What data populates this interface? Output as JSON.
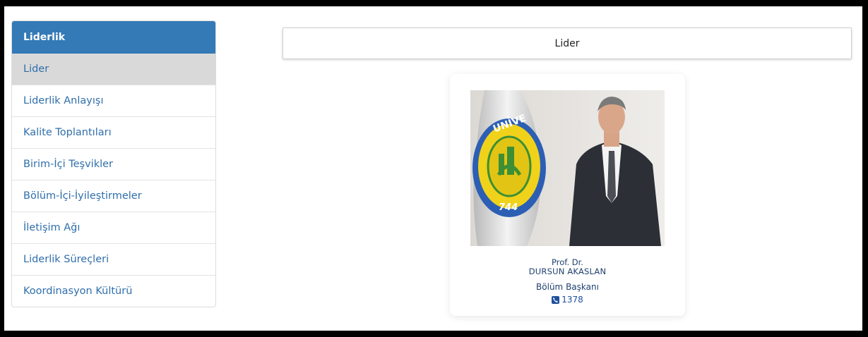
{
  "sidebar": {
    "header": "Liderlik",
    "items": [
      {
        "label": "Lider",
        "active": true
      },
      {
        "label": "Liderlik Anlayışı"
      },
      {
        "label": "Kalite Toplantıları"
      },
      {
        "label": "Birim-İçi Teşvikler"
      },
      {
        "label": "Bölüm-İçi-İyileştirmeler"
      },
      {
        "label": "İletişim Ağı"
      },
      {
        "label": "Liderlik Süreçleri"
      },
      {
        "label": "Koordinasyon Kültürü"
      }
    ]
  },
  "main": {
    "panel_title": "Lider"
  },
  "profile": {
    "photo_icon": "portrait-photo",
    "flag_number": "744",
    "flag_text": "UNİVE",
    "title": "Prof. Dr.",
    "name": "DURSUN AKASLAN",
    "role": "Bölüm Başkanı",
    "phone_icon": "phone-icon",
    "phone": "1378"
  },
  "colors": {
    "accent": "#337ab7",
    "active_bg": "#d9d9d9",
    "link": "#2f6fab"
  }
}
